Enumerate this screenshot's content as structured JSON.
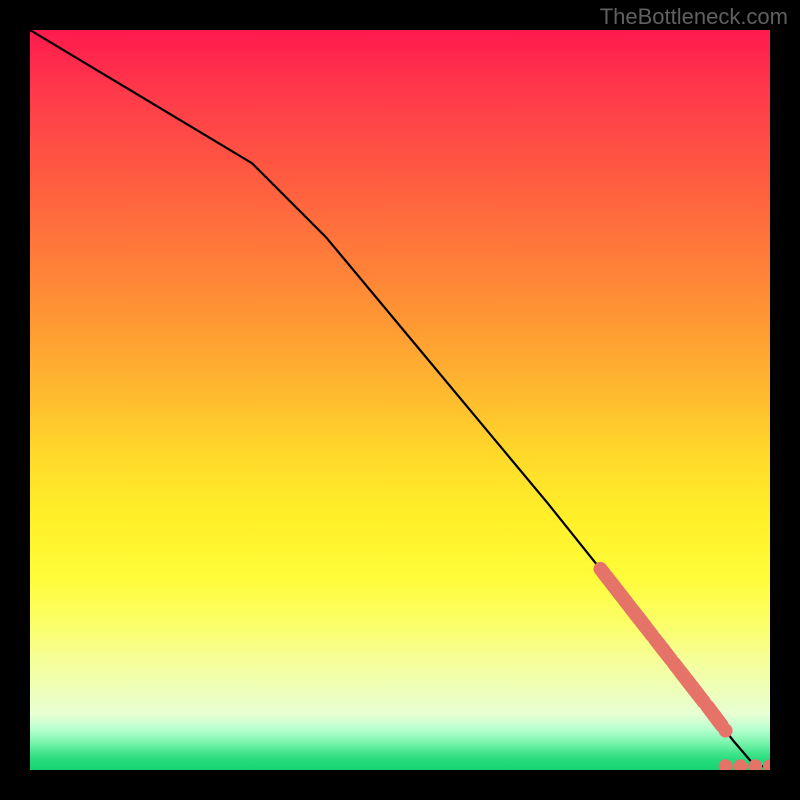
{
  "watermark": "TheBottleneck.com",
  "chart_data": {
    "type": "line",
    "title": "",
    "xlabel": "",
    "ylabel": "",
    "xlim": [
      0,
      100
    ],
    "ylim": [
      0,
      100
    ],
    "grid": false,
    "series": [
      {
        "name": "curve",
        "x": [
          0,
          10,
          20,
          30,
          40,
          50,
          60,
          70,
          78,
          85,
          92,
          95,
          98,
          100
        ],
        "y": [
          100,
          94,
          88,
          82,
          72,
          60,
          48,
          36,
          26,
          17,
          8,
          4,
          0.5,
          0.5
        ],
        "color": "#000000"
      }
    ],
    "dotted_segments": [
      {
        "from_x": 78,
        "to_x": 94,
        "along": "curve"
      },
      {
        "from_x": 94,
        "to_x": 100,
        "along": "flat_bottom"
      }
    ],
    "dot_color": "#e57368",
    "dot_radius_px": 7
  }
}
